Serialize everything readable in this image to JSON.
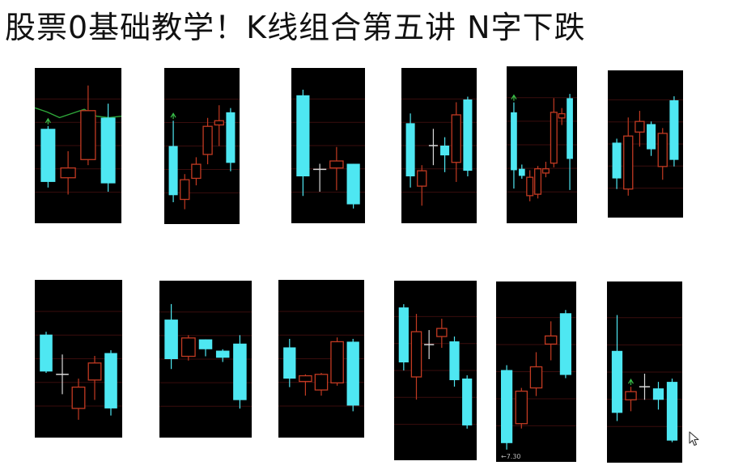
{
  "title": "股票0基础教学！K线组合第五讲 N字下跌",
  "colors": {
    "background": "#000000",
    "up_candle": "#c23a22",
    "down_candle": "#4ee7f2",
    "doji": "#d8d8d8",
    "grid": "#3a0d0d",
    "moving_average": "#2fa83a",
    "marker": "#3ac04a"
  },
  "chart_data": [
    {
      "type": "candlestick",
      "ma": [
        0.77,
        0.74,
        0.7,
        0.73,
        0.76,
        0.71,
        0.7,
        0.71
      ],
      "candles": [
        {
          "dir": "down",
          "open": 0.62,
          "close": 0.24,
          "high": 0.64,
          "low": 0.2,
          "marker": true
        },
        {
          "dir": "up",
          "open": 0.27,
          "close": 0.34,
          "high": 0.46,
          "low": 0.15
        },
        {
          "dir": "up",
          "open": 0.4,
          "close": 0.75,
          "high": 0.93,
          "low": 0.36
        },
        {
          "dir": "down",
          "open": 0.7,
          "close": 0.23,
          "high": 0.8,
          "low": 0.17
        }
      ]
    },
    {
      "type": "candlestick",
      "candles": [
        {
          "dir": "down",
          "open": 0.5,
          "close": 0.15,
          "high": 0.68,
          "low": 0.1,
          "marker": true
        },
        {
          "dir": "up",
          "open": 0.12,
          "close": 0.26,
          "high": 0.3,
          "low": 0.05
        },
        {
          "dir": "up",
          "open": 0.27,
          "close": 0.37,
          "high": 0.42,
          "low": 0.22
        },
        {
          "dir": "up",
          "open": 0.44,
          "close": 0.64,
          "high": 0.7,
          "low": 0.37
        },
        {
          "dir": "up",
          "open": 0.65,
          "close": 0.68,
          "high": 0.79,
          "low": 0.5
        },
        {
          "dir": "down",
          "open": 0.74,
          "close": 0.38,
          "high": 0.77,
          "low": 0.32
        }
      ]
    },
    {
      "type": "candlestick",
      "candles": [
        {
          "dir": "down",
          "open": 0.86,
          "close": 0.28,
          "high": 0.9,
          "low": 0.14
        },
        {
          "dir": "doji",
          "open": 0.33,
          "close": 0.33,
          "high": 0.37,
          "low": 0.17
        },
        {
          "dir": "up",
          "open": 0.34,
          "close": 0.39,
          "high": 0.49,
          "low": 0.18
        },
        {
          "dir": "down",
          "open": 0.37,
          "close": 0.08,
          "high": 0.37,
          "low": 0.05
        }
      ]
    },
    {
      "type": "candlestick",
      "candles": [
        {
          "dir": "down",
          "open": 0.66,
          "close": 0.28,
          "high": 0.73,
          "low": 0.2
        },
        {
          "dir": "up",
          "open": 0.21,
          "close": 0.32,
          "high": 0.36,
          "low": 0.07
        },
        {
          "dir": "doji",
          "open": 0.5,
          "close": 0.5,
          "high": 0.62,
          "low": 0.36
        },
        {
          "dir": "down",
          "open": 0.5,
          "close": 0.43,
          "high": 0.56,
          "low": 0.31
        },
        {
          "dir": "up",
          "open": 0.38,
          "close": 0.72,
          "high": 0.81,
          "low": 0.24
        },
        {
          "dir": "down",
          "open": 0.83,
          "close": 0.32,
          "high": 0.85,
          "low": 0.28
        }
      ]
    },
    {
      "type": "candlestick",
      "candles": [
        {
          "dir": "down",
          "open": 0.73,
          "close": 0.32,
          "high": 0.8,
          "low": 0.19,
          "marker": true
        },
        {
          "dir": "down",
          "open": 0.33,
          "close": 0.28,
          "high": 0.36,
          "low": 0.26
        },
        {
          "dir": "up",
          "open": 0.14,
          "close": 0.27,
          "high": 0.32,
          "low": 0.1
        },
        {
          "dir": "up",
          "open": 0.15,
          "close": 0.33,
          "high": 0.35,
          "low": 0.12
        },
        {
          "dir": "up",
          "open": 0.3,
          "close": 0.33,
          "high": 0.38,
          "low": 0.27
        },
        {
          "dir": "up",
          "open": 0.37,
          "close": 0.73,
          "high": 0.83,
          "low": 0.34
        },
        {
          "dir": "up",
          "open": 0.69,
          "close": 0.72,
          "high": 0.76,
          "low": 0.64
        },
        {
          "dir": "down",
          "open": 0.83,
          "close": 0.4,
          "high": 0.86,
          "low": 0.18
        }
      ]
    },
    {
      "type": "candlestick",
      "candles": [
        {
          "dir": "down",
          "open": 0.51,
          "close": 0.24,
          "high": 0.54,
          "low": 0.16
        },
        {
          "dir": "up",
          "open": 0.16,
          "close": 0.56,
          "high": 0.7,
          "low": 0.11
        },
        {
          "dir": "up",
          "open": 0.59,
          "close": 0.67,
          "high": 0.75,
          "low": 0.48
        },
        {
          "dir": "down",
          "open": 0.65,
          "close": 0.46,
          "high": 0.67,
          "low": 0.41
        },
        {
          "dir": "up",
          "open": 0.33,
          "close": 0.58,
          "high": 0.62,
          "low": 0.23
        },
        {
          "dir": "down",
          "open": 0.83,
          "close": 0.38,
          "high": 0.86,
          "low": 0.33
        }
      ]
    },
    {
      "type": "candlestick",
      "candles": [
        {
          "dir": "down",
          "open": 0.67,
          "close": 0.41,
          "high": 0.69,
          "low": 0.4
        },
        {
          "dir": "doji",
          "open": 0.39,
          "close": 0.39,
          "high": 0.53,
          "low": 0.25
        },
        {
          "dir": "up",
          "open": 0.15,
          "close": 0.3,
          "high": 0.36,
          "low": 0.07
        },
        {
          "dir": "up",
          "open": 0.35,
          "close": 0.47,
          "high": 0.52,
          "low": 0.21
        },
        {
          "dir": "down",
          "open": 0.54,
          "close": 0.15,
          "high": 0.56,
          "low": 0.1
        }
      ]
    },
    {
      "type": "candlestick",
      "candles": [
        {
          "dir": "down",
          "open": 0.78,
          "close": 0.5,
          "high": 0.89,
          "low": 0.43
        },
        {
          "dir": "up",
          "open": 0.52,
          "close": 0.65,
          "high": 0.67,
          "low": 0.49
        },
        {
          "dir": "down",
          "open": 0.64,
          "close": 0.57,
          "high": 0.64,
          "low": 0.52
        },
        {
          "dir": "down",
          "open": 0.56,
          "close": 0.51,
          "high": 0.57,
          "low": 0.48
        },
        {
          "dir": "down",
          "open": 0.61,
          "close": 0.21,
          "high": 0.67,
          "low": 0.15
        }
      ]
    },
    {
      "type": "candlestick",
      "candles": [
        {
          "dir": "down",
          "open": 0.58,
          "close": 0.36,
          "high": 0.64,
          "low": 0.3
        },
        {
          "dir": "up",
          "open": 0.34,
          "close": 0.38,
          "high": 0.39,
          "low": 0.24
        },
        {
          "dir": "up",
          "open": 0.28,
          "close": 0.39,
          "high": 0.4,
          "low": 0.24
        },
        {
          "dir": "up",
          "open": 0.33,
          "close": 0.62,
          "high": 0.65,
          "low": 0.31
        },
        {
          "dir": "down",
          "open": 0.62,
          "close": 0.17,
          "high": 0.64,
          "low": 0.13
        }
      ]
    },
    {
      "type": "candlestick",
      "candles": [
        {
          "dir": "down",
          "open": 0.89,
          "close": 0.55,
          "high": 0.91,
          "low": 0.5
        },
        {
          "dir": "up",
          "open": 0.46,
          "close": 0.74,
          "high": 0.85,
          "low": 0.32
        },
        {
          "dir": "doji",
          "open": 0.66,
          "close": 0.66,
          "high": 0.75,
          "low": 0.57
        },
        {
          "dir": "up",
          "open": 0.71,
          "close": 0.76,
          "high": 0.82,
          "low": 0.64
        },
        {
          "dir": "down",
          "open": 0.68,
          "close": 0.44,
          "high": 0.71,
          "low": 0.4
        },
        {
          "dir": "down",
          "open": 0.45,
          "close": 0.16,
          "high": 0.47,
          "low": 0.14
        }
      ]
    },
    {
      "type": "candlestick",
      "label": "7.30",
      "candles": [
        {
          "dir": "down",
          "open": 0.51,
          "close": 0.06,
          "high": 0.54,
          "low": 0.02
        },
        {
          "dir": "up",
          "open": 0.18,
          "close": 0.38,
          "high": 0.4,
          "low": 0.15
        },
        {
          "dir": "up",
          "open": 0.4,
          "close": 0.53,
          "high": 0.62,
          "low": 0.35
        },
        {
          "dir": "up",
          "open": 0.67,
          "close": 0.72,
          "high": 0.81,
          "low": 0.57
        },
        {
          "dir": "down",
          "open": 0.86,
          "close": 0.48,
          "high": 0.88,
          "low": 0.46
        }
      ]
    },
    {
      "type": "candlestick",
      "candles": [
        {
          "dir": "down",
          "open": 0.63,
          "close": 0.25,
          "high": 0.85,
          "low": 0.2
        },
        {
          "dir": "up",
          "open": 0.33,
          "close": 0.38,
          "high": 0.41,
          "low": 0.26,
          "marker": true
        },
        {
          "dir": "doji",
          "open": 0.41,
          "close": 0.41,
          "high": 0.49,
          "low": 0.33
        },
        {
          "dir": "down",
          "open": 0.4,
          "close": 0.33,
          "high": 0.44,
          "low": 0.27
        },
        {
          "dir": "down",
          "open": 0.44,
          "close": 0.08,
          "high": 0.46,
          "low": 0.07
        }
      ]
    }
  ]
}
